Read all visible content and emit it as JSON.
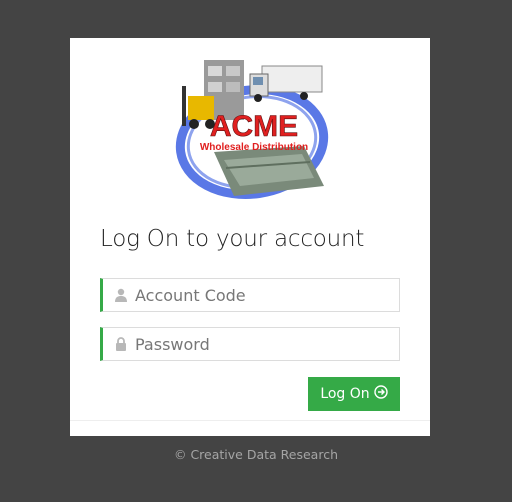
{
  "logo": {
    "brand": "ACME",
    "tagline": "Wholesale Distribution",
    "colors": {
      "brand_red": "#e02020",
      "ring_blue": "#5a78e6"
    }
  },
  "form": {
    "title": "Log On to your account",
    "account_code": {
      "placeholder": "Account Code",
      "icon": "user-icon",
      "value": ""
    },
    "password": {
      "placeholder": "Password",
      "icon": "lock-icon",
      "value": ""
    },
    "submit_label": "Log On",
    "submit_icon": "arrow-circle-right-icon",
    "accent_color": "#35aa47"
  },
  "footer": {
    "copyright": "© Creative Data Research"
  }
}
